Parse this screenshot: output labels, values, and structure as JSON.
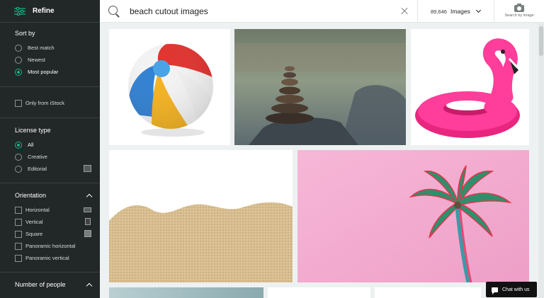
{
  "refine": {
    "label": "Refine"
  },
  "sort_by": {
    "title": "Sort by",
    "options": [
      "Best match",
      "Newest",
      "Most popular"
    ],
    "selected": "Most popular"
  },
  "istock_filter": {
    "label": "Only from iStock"
  },
  "license_type": {
    "title": "License type",
    "options": [
      "All",
      "Creative",
      "Editorial"
    ],
    "selected": "All"
  },
  "orientation": {
    "title": "Orientation",
    "options": [
      "Horizontal",
      "Vertical",
      "Square",
      "Panoramic horizontal",
      "Panoramic vertical"
    ]
  },
  "number_of_people": {
    "title": "Number of people"
  },
  "search": {
    "query": "beach cutout images"
  },
  "media": {
    "count": "89,646",
    "label": "Images"
  },
  "search_by_image": {
    "label": "Search by image"
  },
  "images": [
    {
      "name": "beach-ball"
    },
    {
      "name": "stacked-stones"
    },
    {
      "name": "pink-flamingo-float"
    },
    {
      "name": "sand"
    },
    {
      "name": "palm-tree-pink"
    }
  ],
  "chat": {
    "label": "Chat with us"
  },
  "colors": {
    "accent": "#12b886",
    "sidebar": "#222728"
  }
}
